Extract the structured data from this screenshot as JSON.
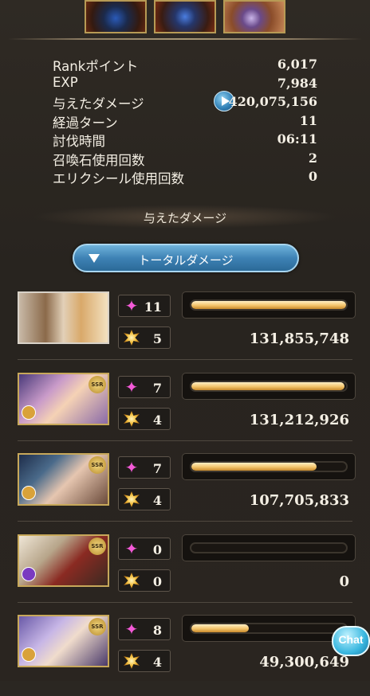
{
  "stats": [
    {
      "label": "Rankポイント",
      "value": "6,017"
    },
    {
      "label": "EXP",
      "value": "7,984"
    },
    {
      "label": "与えたダメージ",
      "value": "420,075,156"
    },
    {
      "label": "経過ターン",
      "value": "11"
    },
    {
      "label": "討伐時間",
      "value": "06:11"
    },
    {
      "label": "召喚石使用回数",
      "value": "2"
    },
    {
      "label": "エリクシール使用回数",
      "value": "0"
    }
  ],
  "section_title": "与えたダメージ",
  "dropdown_label": "トータルダメージ",
  "chat_label": "Chat",
  "rows": [
    {
      "portrait": "main-character",
      "attacks": "11",
      "skills": "5",
      "damage": "131,855,748",
      "bar_fraction": 1.0
    },
    {
      "portrait": "character-2",
      "attacks": "7",
      "skills": "4",
      "damage": "131,212,926",
      "bar_fraction": 0.99
    },
    {
      "portrait": "character-3",
      "attacks": "7",
      "skills": "4",
      "damage": "107,705,833",
      "bar_fraction": 0.81
    },
    {
      "portrait": "character-4",
      "attacks": "0",
      "skills": "0",
      "damage": "0",
      "bar_fraction": 0.0
    },
    {
      "portrait": "character-5",
      "attacks": "8",
      "skills": "4",
      "damage": "49,300,649",
      "bar_fraction": 0.37
    }
  ]
}
